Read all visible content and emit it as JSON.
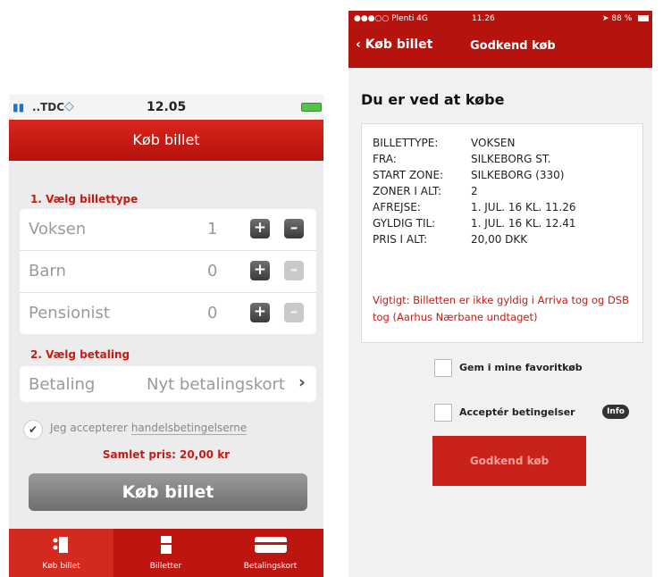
{
  "left": {
    "status": {
      "signal": "▮▮",
      "carrier": "..TDC",
      "wifi": "◇",
      "time": "12.05"
    },
    "title": "Køb billet",
    "section1": "1. Vælg billettype",
    "tickets": [
      {
        "name": "Voksen",
        "count": "1"
      },
      {
        "name": "Barn",
        "count": "0"
      },
      {
        "name": "Pensionist",
        "count": "0"
      }
    ],
    "plus": "+",
    "minus": "–",
    "section2": "2. Vælg betaling",
    "payment_label": "Betaling",
    "payment_value": "Nyt betalingskort",
    "accept_prefix": "Jeg accepterer",
    "accept_link": "handelsbetingelserne",
    "check": "✔",
    "total": "Samlet pris: 20,00 kr",
    "buy_button": "Køb billet",
    "tabs": [
      {
        "label": "Køb billet"
      },
      {
        "label": "Billetter"
      },
      {
        "label": "Betalingskort"
      }
    ]
  },
  "right": {
    "status": {
      "carrier": "●●●○○ Plenti  4G",
      "time": "11.26",
      "battery": "➤ 88 %"
    },
    "back": "‹ Køb billet",
    "title": "Godkend køb",
    "heading": "Du er ved at købe",
    "details": [
      {
        "key": "BILLETTYPE:",
        "value": "VOKSEN"
      },
      {
        "key": "FRA:",
        "value": "SILKEBORG ST."
      },
      {
        "key": "START ZONE:",
        "value": "SILKEBORG (330)"
      },
      {
        "key": "ZONER I ALT:",
        "value": "2"
      },
      {
        "key": "AFREJSE:",
        "value": "1. JUL. 16 KL. 11.26"
      },
      {
        "key": "GYLDIG TIL:",
        "value": "1. JUL. 16 KL. 12.41"
      },
      {
        "key": "PRIS I ALT:",
        "value": "20,00 DKK"
      }
    ],
    "warning": "Vigtigt: Billetten er ikke gyldig i Arriva tog og DSB tog (Aarhus Nærbane undtaget)",
    "favorite_label": "Gem i mine favoritkøb",
    "accept_label": "Acceptér betingelser",
    "info_badge": "Info",
    "confirm_button": "Godkend køb"
  },
  "colors": {
    "brand_red": "#c41b12",
    "nav_red": "#b5130e"
  }
}
